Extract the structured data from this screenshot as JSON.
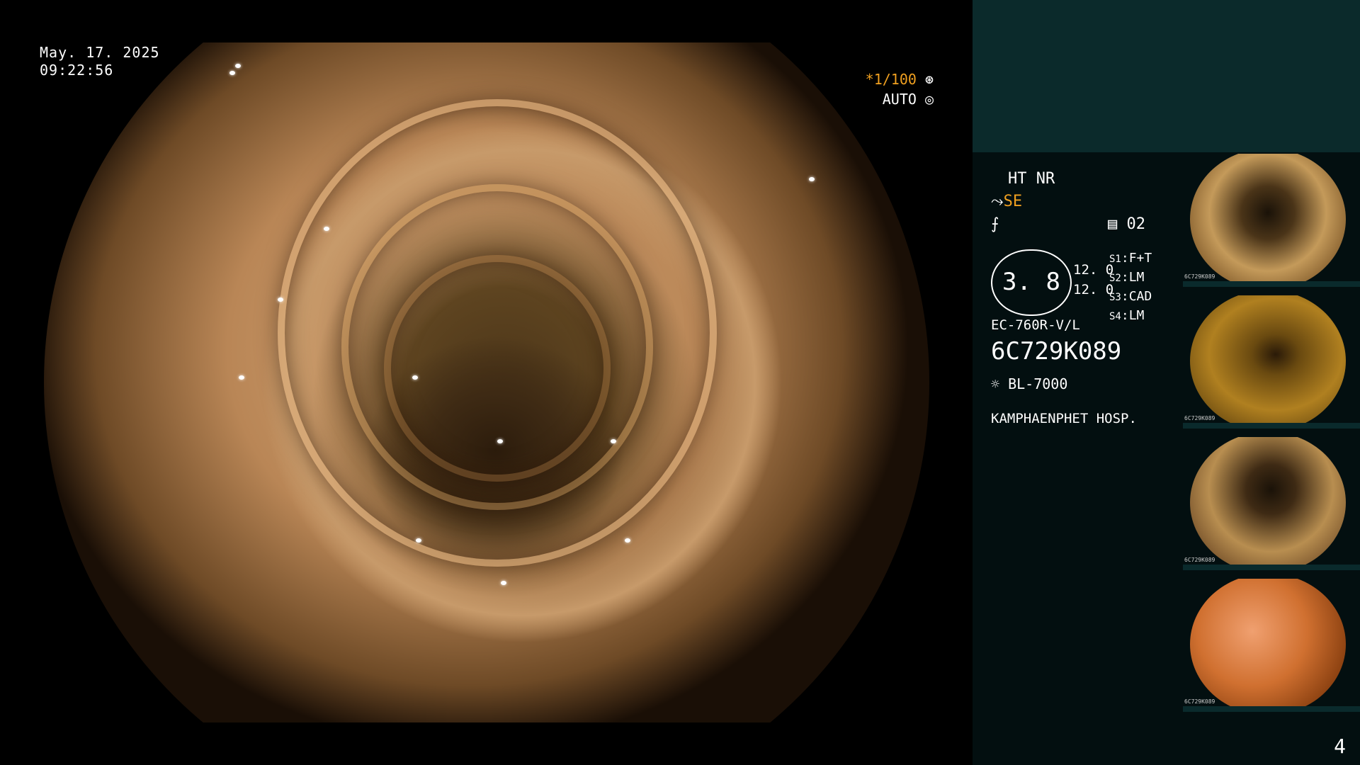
{
  "overlay": {
    "date": "May. 17. 2025",
    "time": "09:22:56",
    "shutter": "*1/100",
    "iris": "AUTO"
  },
  "panel": {
    "mode": "HT NR",
    "enhance": "SE",
    "enhance_color": "#f0a020",
    "memory_channel": "02",
    "zoom_value": "3. 8",
    "scale_a": "12. 0",
    "scale_b": "12. 0",
    "switches": [
      {
        "key": "S1",
        "value": "F+T"
      },
      {
        "key": "S2",
        "value": "LM"
      },
      {
        "key": "S3",
        "value": "CAD"
      },
      {
        "key": "S4",
        "value": "LM"
      }
    ],
    "scope_model": "EC-760R-V/L",
    "serial": "6C729K089",
    "light_source": "BL-7000",
    "hospital": "KAMPHAENPHET HOSP."
  },
  "thumbnails": [
    {
      "label": "6C729K089"
    },
    {
      "label": "6C729K089"
    },
    {
      "label": "6C729K089"
    },
    {
      "label": "6C729K089"
    }
  ],
  "page_number": "4"
}
